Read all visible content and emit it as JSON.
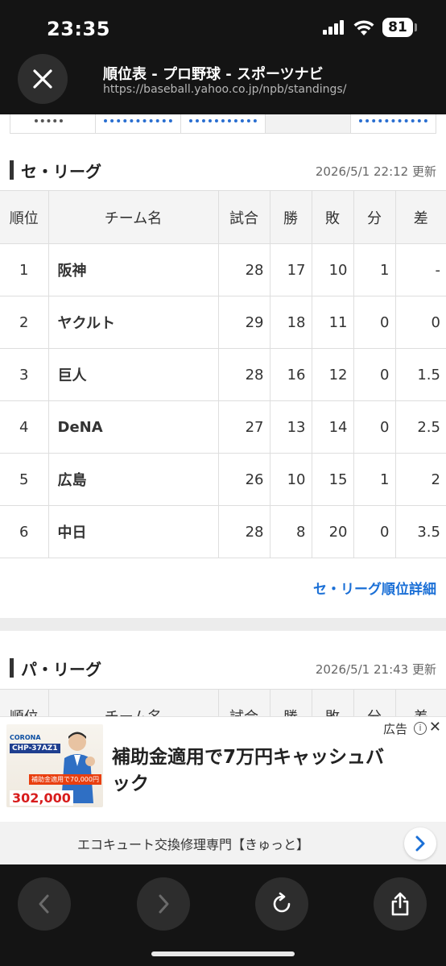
{
  "status": {
    "time": "23:35",
    "battery": "81"
  },
  "header": {
    "title": "順位表 - プロ野球 - スポーツナビ",
    "url": "https://baseball.yahoo.co.jp/npb/standings/"
  },
  "central": {
    "name": "セ・リーグ",
    "updated": "2026/5/1 22:12 更新",
    "columns": [
      "順位",
      "チーム名",
      "試合",
      "勝",
      "敗",
      "分",
      "差"
    ],
    "rows": [
      {
        "rank": "1",
        "team": "阪神",
        "games": "28",
        "wins": "17",
        "losses": "10",
        "ties": "1",
        "gb": "-"
      },
      {
        "rank": "2",
        "team": "ヤクルト",
        "games": "29",
        "wins": "18",
        "losses": "11",
        "ties": "0",
        "gb": "0"
      },
      {
        "rank": "3",
        "team": "巨人",
        "games": "28",
        "wins": "16",
        "losses": "12",
        "ties": "0",
        "gb": "1.5"
      },
      {
        "rank": "4",
        "team": "DeNA",
        "games": "27",
        "wins": "13",
        "losses": "14",
        "ties": "0",
        "gb": "2.5"
      },
      {
        "rank": "5",
        "team": "広島",
        "games": "26",
        "wins": "10",
        "losses": "15",
        "ties": "1",
        "gb": "2"
      },
      {
        "rank": "6",
        "team": "中日",
        "games": "28",
        "wins": "8",
        "losses": "20",
        "ties": "0",
        "gb": "3.5"
      }
    ],
    "detail_link": "セ・リーグ順位詳細"
  },
  "pacific": {
    "name": "パ・リーグ",
    "updated": "2026/5/1 21:43 更新",
    "columns": [
      "順位",
      "チーム名",
      "試合",
      "勝",
      "敗",
      "分",
      "差"
    ]
  },
  "ad": {
    "label": "広告",
    "headline": "補助金適用で7万円キャッシュバック",
    "image_logo": "CORONA",
    "image_model": "CHP-37AZ1",
    "image_subsidy": "補助金適用で70,000円",
    "image_price": "302,000",
    "advertiser": "エコキュート交換修理専門【きゅっと】"
  },
  "icons": {
    "close": "close-icon",
    "back": "chevron-left-icon",
    "forward": "chevron-right-icon",
    "reload": "reload-icon",
    "share": "share-icon",
    "ad_go": "chevron-right-icon"
  },
  "colors": {
    "link": "#1a6fd6",
    "chrome": "#141414"
  }
}
